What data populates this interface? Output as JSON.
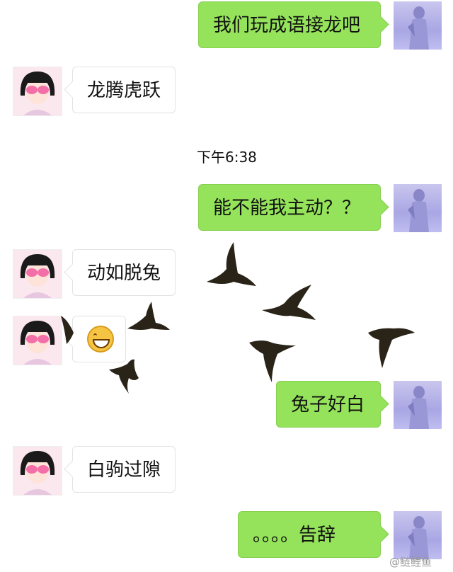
{
  "messages": [
    {
      "side": "out",
      "text": "我们玩成语接龙吧"
    },
    {
      "side": "in",
      "text": "龙腾虎跃"
    },
    {
      "side": "out",
      "text": "能不能我主动？？"
    },
    {
      "side": "in",
      "text": "动如脱兔"
    },
    {
      "side": "in",
      "text": "😁",
      "emoji": "grin-emoji"
    },
    {
      "side": "out",
      "text": "兔子好白"
    },
    {
      "side": "in",
      "text": "白驹过隙"
    },
    {
      "side": "out",
      "text": "。。。。告辞"
    }
  ],
  "timestamp": "下午6:38",
  "watermark": "@鲢鲤鱼",
  "icons": {
    "left_avatar": "girl-avatar-icon",
    "right_avatar": "photo-avatar-icon",
    "decoration": "flying-birds-icon"
  },
  "colors": {
    "outgoing_bubble": "#95e35a",
    "incoming_bubble": "#ffffff"
  }
}
